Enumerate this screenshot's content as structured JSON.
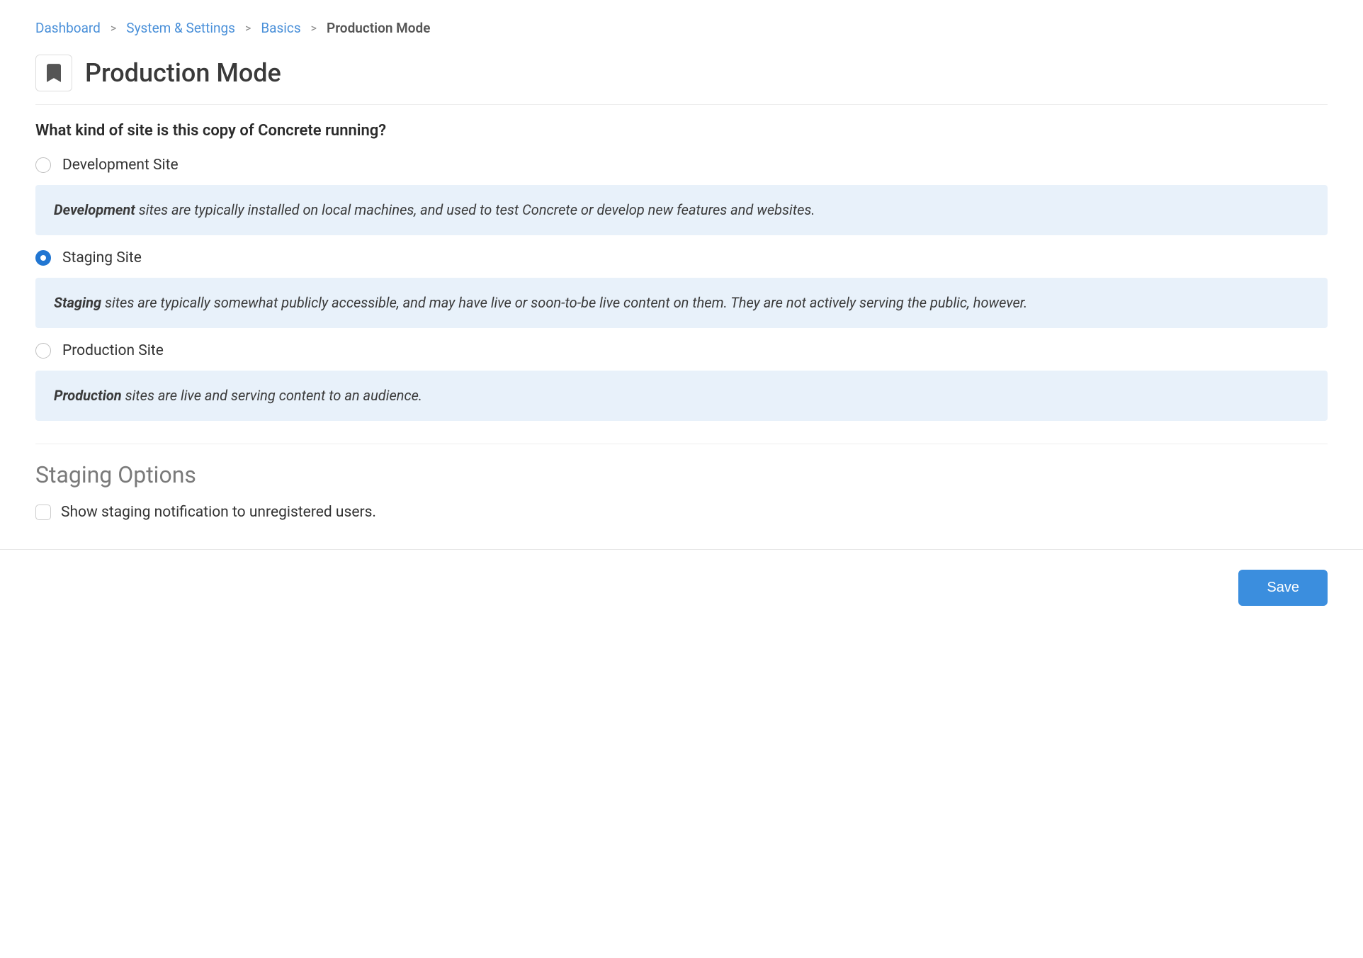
{
  "breadcrumb": {
    "items": [
      {
        "label": "Dashboard"
      },
      {
        "label": "System & Settings"
      },
      {
        "label": "Basics"
      }
    ],
    "current": "Production Mode"
  },
  "header": {
    "title": "Production Mode"
  },
  "question": "What kind of site is this copy of Concrete running?",
  "options": {
    "dev": {
      "label": "Development Site",
      "help_bold": "Development",
      "help_rest": " sites are typically installed on local machines, and used to test Concrete or develop new features and websites.",
      "checked": false
    },
    "staging": {
      "label": "Staging Site",
      "help_bold": "Staging",
      "help_rest": " sites are typically somewhat publicly accessible, and may have live or soon-to-be live content on them. They are not actively serving the public, however.",
      "checked": true
    },
    "production": {
      "label": "Production Site",
      "help_bold": "Production",
      "help_rest": " sites are live and serving content to an audience.",
      "checked": false
    }
  },
  "staging_options": {
    "title": "Staging Options",
    "show_notification_label": "Show staging notification to unregistered users.",
    "show_notification_checked": false
  },
  "footer": {
    "save_label": "Save"
  }
}
